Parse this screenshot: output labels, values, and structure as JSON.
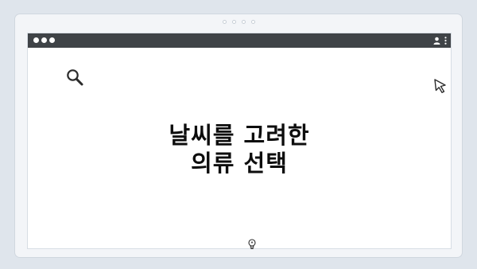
{
  "headline": {
    "line1": "날씨를 고려한",
    "line2": "의류 선택"
  },
  "icons": {
    "search": "search-icon",
    "cursor": "cursor-icon",
    "bulb": "lightbulb-icon",
    "profile": "profile-icon",
    "menu": "kebab-menu-icon"
  },
  "colors": {
    "background": "#dfe5ec",
    "titlebar": "#3f4347",
    "text": "#0d0d0d"
  }
}
